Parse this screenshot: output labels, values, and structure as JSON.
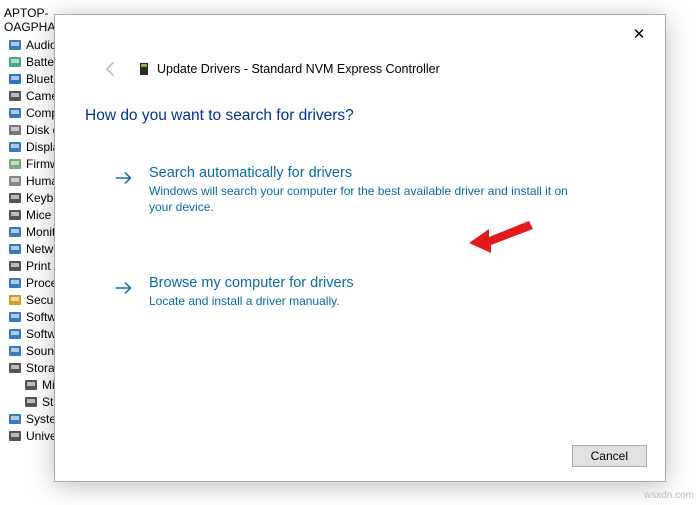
{
  "tree": {
    "computer": "APTOP-OAGPHAAL",
    "items": [
      {
        "label": "Audio i",
        "icon": "speaker"
      },
      {
        "label": "Batterie",
        "icon": "battery"
      },
      {
        "label": "Bluetoc",
        "icon": "bluetooth"
      },
      {
        "label": "Camer",
        "icon": "camera"
      },
      {
        "label": "Compu",
        "icon": "monitor"
      },
      {
        "label": "Disk dr",
        "icon": "disk"
      },
      {
        "label": "Display",
        "icon": "monitor"
      },
      {
        "label": "Firmwa",
        "icon": "chip"
      },
      {
        "label": "Humar",
        "icon": "hid"
      },
      {
        "label": "Keyboa",
        "icon": "keyboard"
      },
      {
        "label": "Mice a",
        "icon": "mouse"
      },
      {
        "label": "Monito",
        "icon": "monitor"
      },
      {
        "label": "Netwo",
        "icon": "network"
      },
      {
        "label": "Print q",
        "icon": "printer"
      },
      {
        "label": "Proces",
        "icon": "cpu"
      },
      {
        "label": "Securit",
        "icon": "lock"
      },
      {
        "label": "Softwa",
        "icon": "software"
      },
      {
        "label": "Softwa",
        "icon": "software"
      },
      {
        "label": "Sound,",
        "icon": "sound"
      },
      {
        "label": "Storag",
        "icon": "storage"
      },
      {
        "label": "Micr",
        "icon": "storage"
      },
      {
        "label": "Star",
        "icon": "storage"
      },
      {
        "label": "System",
        "icon": "system"
      },
      {
        "label": "Univers",
        "icon": "usb"
      }
    ]
  },
  "dialog": {
    "title": "Update Drivers - Standard NVM Express Controller",
    "question": "How do you want to search for drivers?",
    "options": [
      {
        "title": "Search automatically for drivers",
        "desc": "Windows will search your computer for the best available driver and install it on your device."
      },
      {
        "title": "Browse my computer for drivers",
        "desc": "Locate and install a driver manually."
      }
    ],
    "cancel": "Cancel"
  },
  "watermark": "wsxdn.com"
}
